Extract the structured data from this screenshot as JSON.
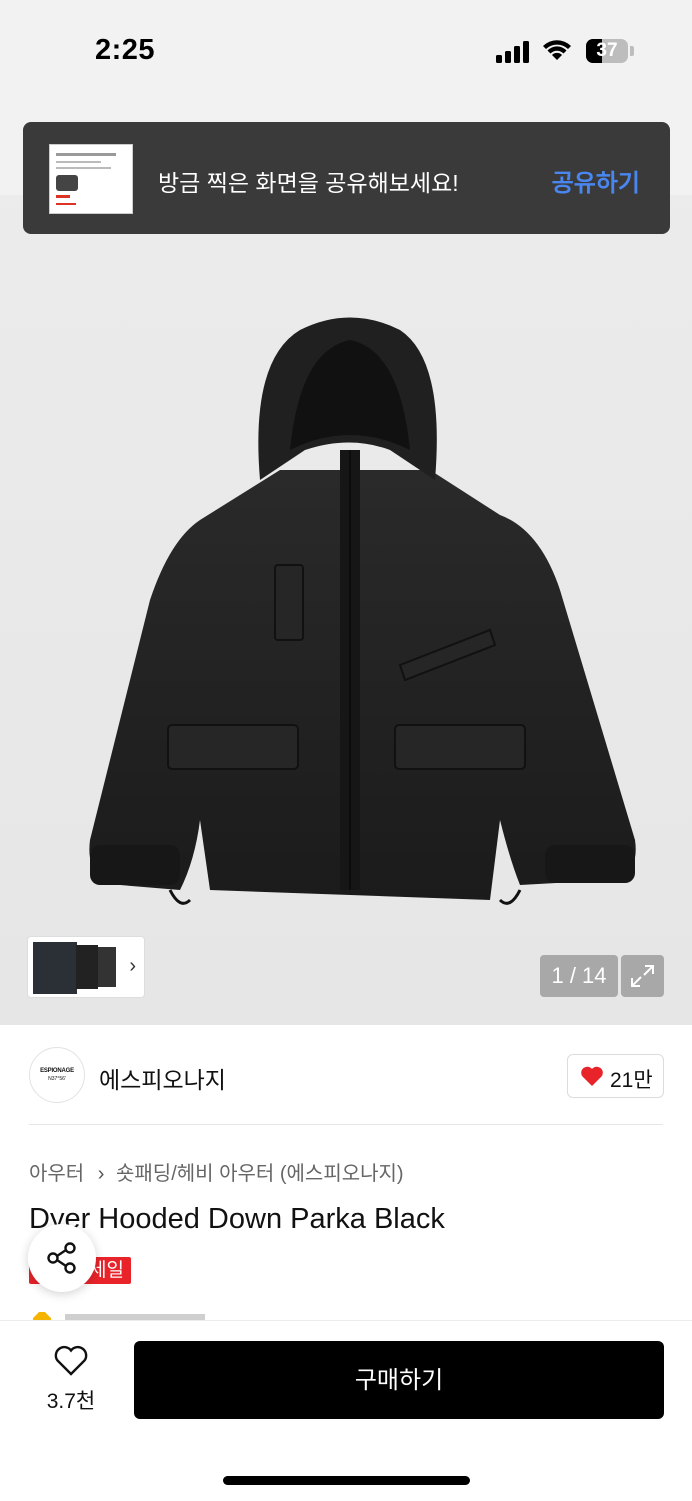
{
  "status_bar": {
    "time": "2:25",
    "battery": "37"
  },
  "toast": {
    "message": "방금 찍은 화면을 공유해보세요!",
    "action": "공유하기"
  },
  "gallery": {
    "pager": "1 / 14",
    "thumb_more_icon": "chevron-right-icon",
    "expand_icon": "expand-icon"
  },
  "brand": {
    "name": "에스피오나지",
    "logo_text": "ESPIONAGE",
    "logo_sub": "N37°56'",
    "likes": "21만"
  },
  "breadcrumb": {
    "root": "아우터",
    "sub": "숏패딩/헤비 아우터 (에스피오나지)"
  },
  "product": {
    "title": "Dyer Hooded Down Parka Black",
    "badge": "세일"
  },
  "bottom": {
    "wish_count": "3.7천",
    "buy_label": "구매하기"
  },
  "colors": {
    "accent_blue": "#4a86f0",
    "sale_red": "#e8232a",
    "heart_red": "#e8232a"
  }
}
